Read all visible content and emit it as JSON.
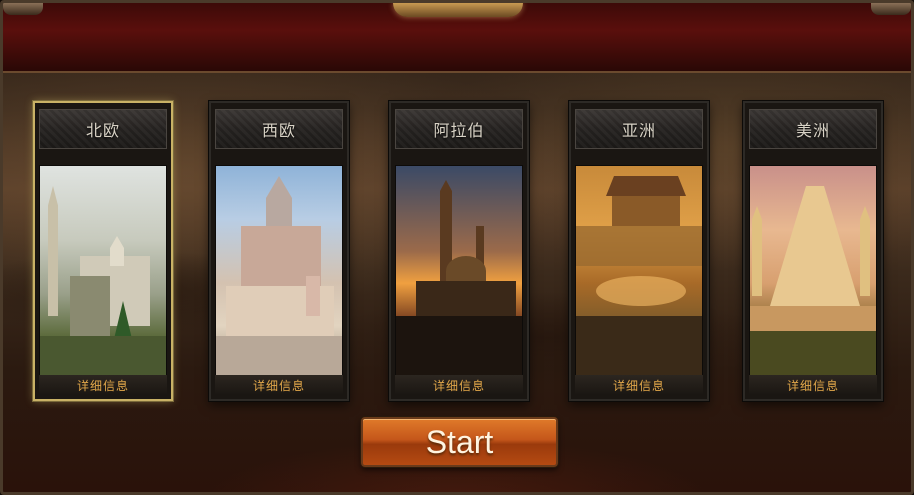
{
  "regions": [
    {
      "name": "北欧",
      "info_label": "详细信息",
      "selected": true
    },
    {
      "name": "西欧",
      "info_label": "详细信息",
      "selected": false
    },
    {
      "name": "阿拉伯",
      "info_label": "详细信息",
      "selected": false
    },
    {
      "name": "亚洲",
      "info_label": "详细信息",
      "selected": false
    },
    {
      "name": "美洲",
      "info_label": "详细信息",
      "selected": false
    }
  ],
  "start_button": {
    "label": "Start"
  },
  "colors": {
    "selected_border": "#c9b266",
    "info_text": "#e3a84a",
    "start_button": "#c4561a"
  }
}
